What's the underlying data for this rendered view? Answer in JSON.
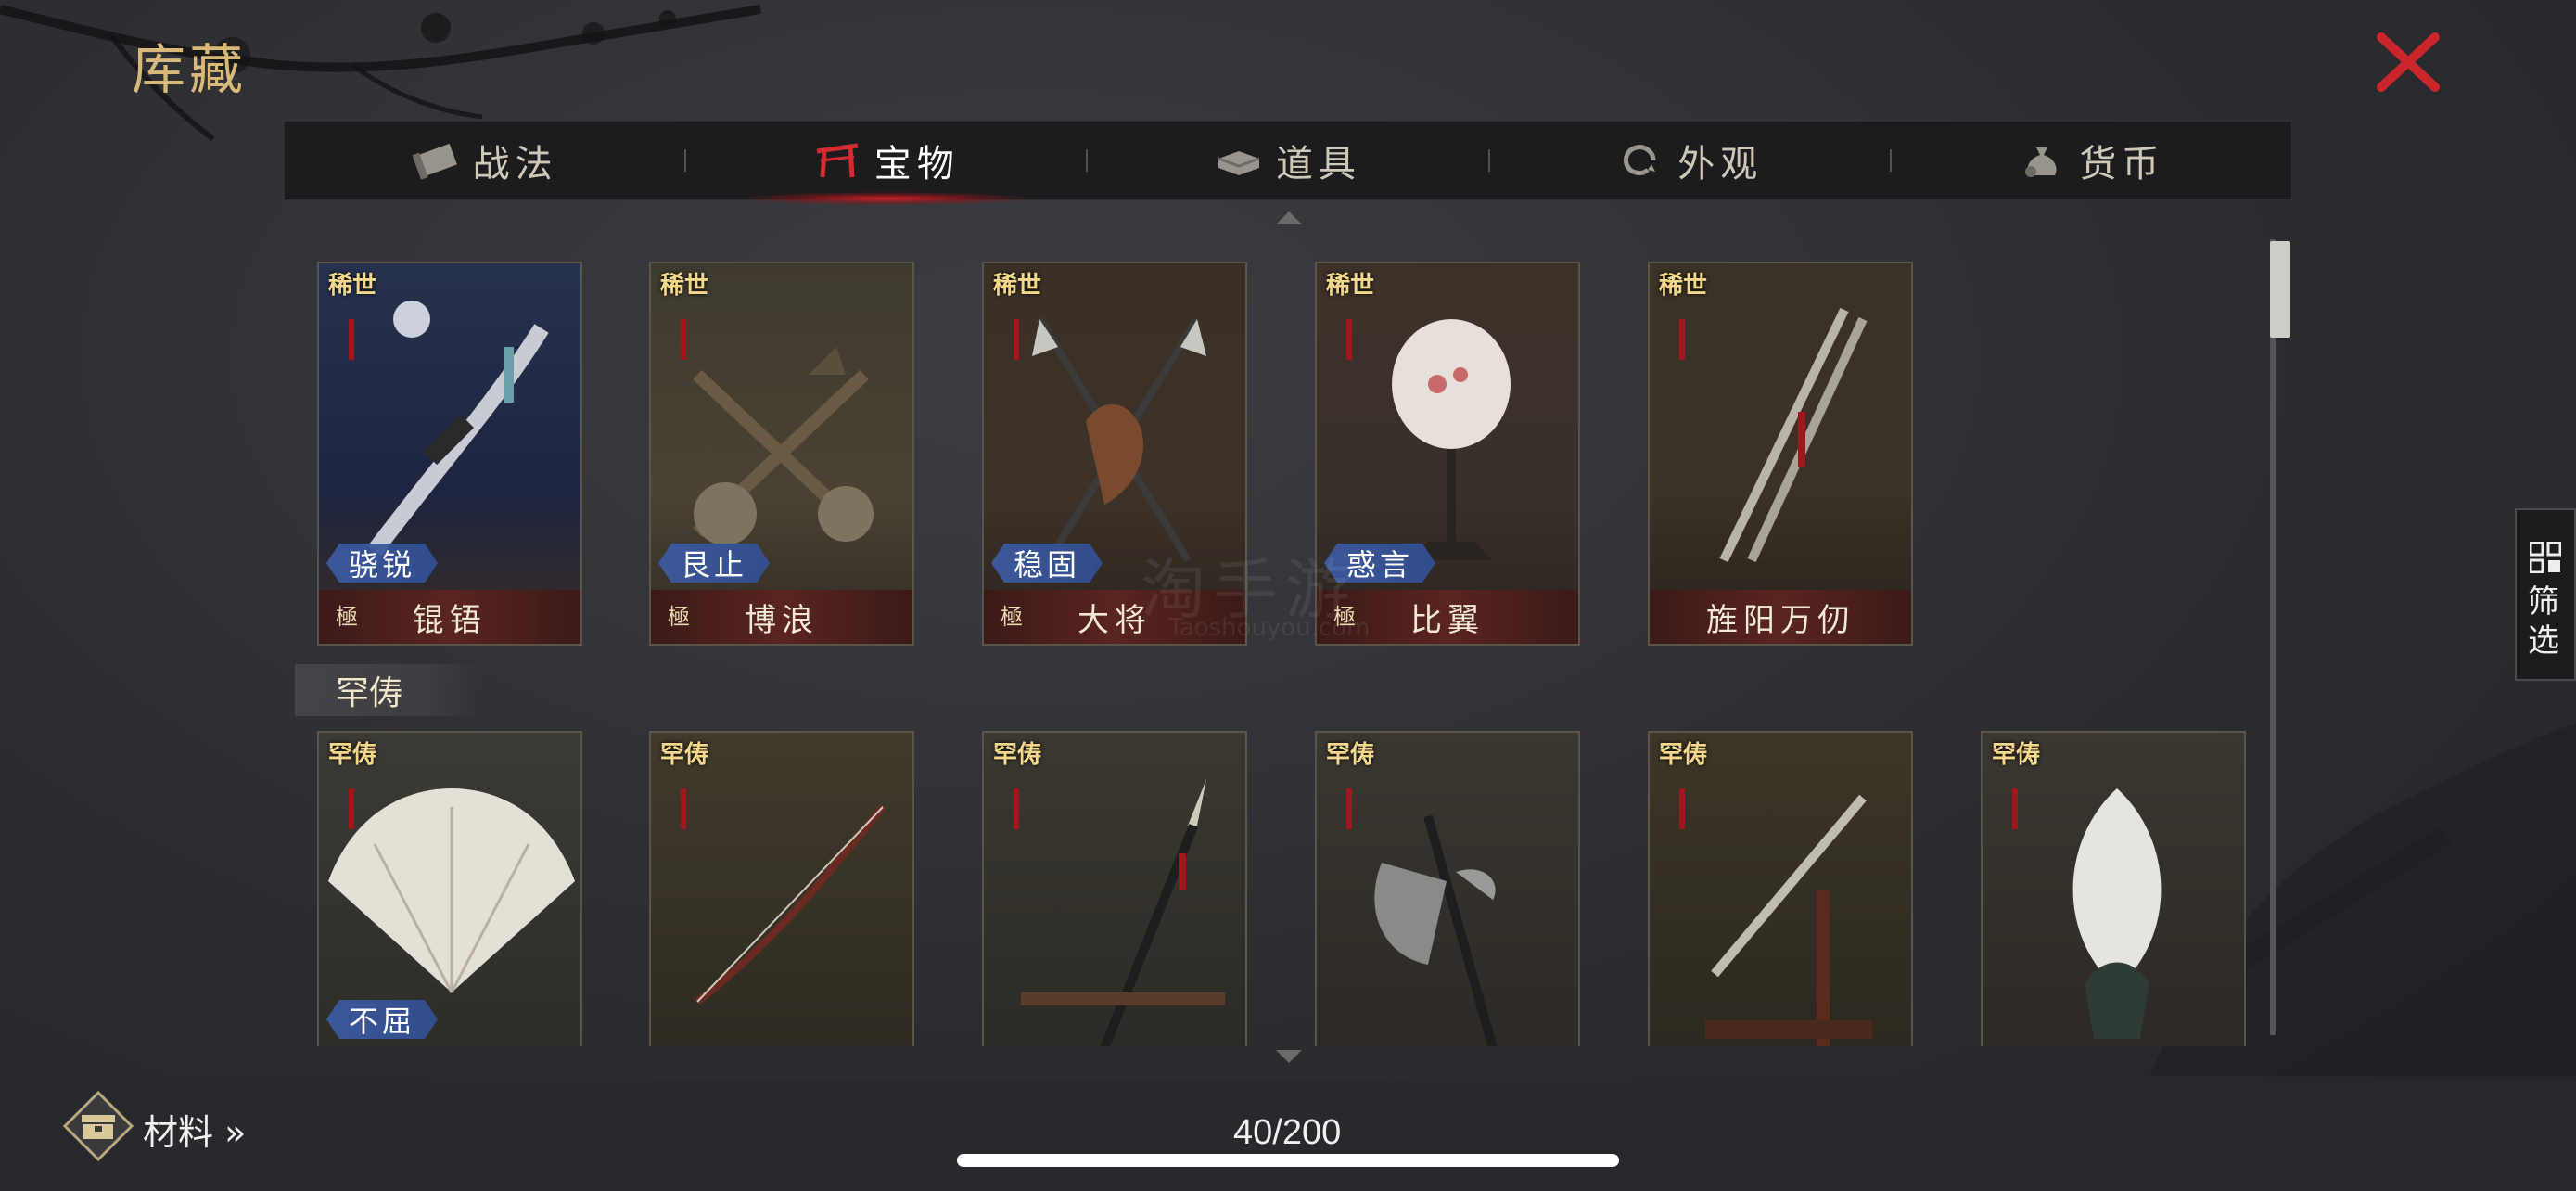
{
  "window": {
    "title": "库藏"
  },
  "tabs": [
    {
      "label": "战法",
      "icon": "scroll-icon",
      "active": false
    },
    {
      "label": "宝物",
      "icon": "treasure-gate-icon",
      "active": true
    },
    {
      "label": "道具",
      "icon": "ingot-icon",
      "active": false
    },
    {
      "label": "外观",
      "icon": "swirl-icon",
      "active": false
    },
    {
      "label": "货币",
      "icon": "money-bag-icon",
      "active": false
    }
  ],
  "sections": [
    {
      "title": "",
      "cards": [
        {
          "badge": "稀世",
          "trait": "骁锐",
          "grade": "極",
          "name": "锟铻",
          "theme": "#2e3a5c"
        },
        {
          "badge": "稀世",
          "trait": "艮止",
          "grade": "極",
          "name": "博浪",
          "theme": "#4a4236"
        },
        {
          "badge": "稀世",
          "trait": "稳固",
          "grade": "極",
          "name": "大将",
          "theme": "#3e3228"
        },
        {
          "badge": "稀世",
          "trait": "惑言",
          "grade": "極",
          "name": "比翼",
          "theme": "#3a302a"
        },
        {
          "badge": "稀世",
          "trait": "",
          "grade": "",
          "name": "旌阳万仞",
          "theme": "#3a3226"
        }
      ]
    },
    {
      "title": "罕俦",
      "cards": [
        {
          "badge": "罕俦",
          "trait": "不屈",
          "name": "",
          "theme": "#3c3a34"
        },
        {
          "badge": "罕俦",
          "trait": "",
          "name": "",
          "theme": "#403a2c"
        },
        {
          "badge": "罕俦",
          "trait": "",
          "name": "",
          "theme": "#3a3830"
        },
        {
          "badge": "罕俦",
          "trait": "",
          "name": "",
          "theme": "#3a3630"
        },
        {
          "badge": "罕俦",
          "trait": "",
          "name": "",
          "theme": "#3c3628"
        },
        {
          "badge": "罕俦",
          "trait": "",
          "name": "",
          "theme": "#3a3630"
        }
      ]
    }
  ],
  "filter": {
    "label": "筛选"
  },
  "bottom": {
    "materials_label": "材料 »",
    "count": "40/200"
  },
  "watermark": {
    "main": "淘手游",
    "sub": "Taoshouyou.com"
  },
  "colors": {
    "accent_red": "#c8242a",
    "gold": "#d8b978",
    "trait_blue": "#3c5aa0"
  }
}
